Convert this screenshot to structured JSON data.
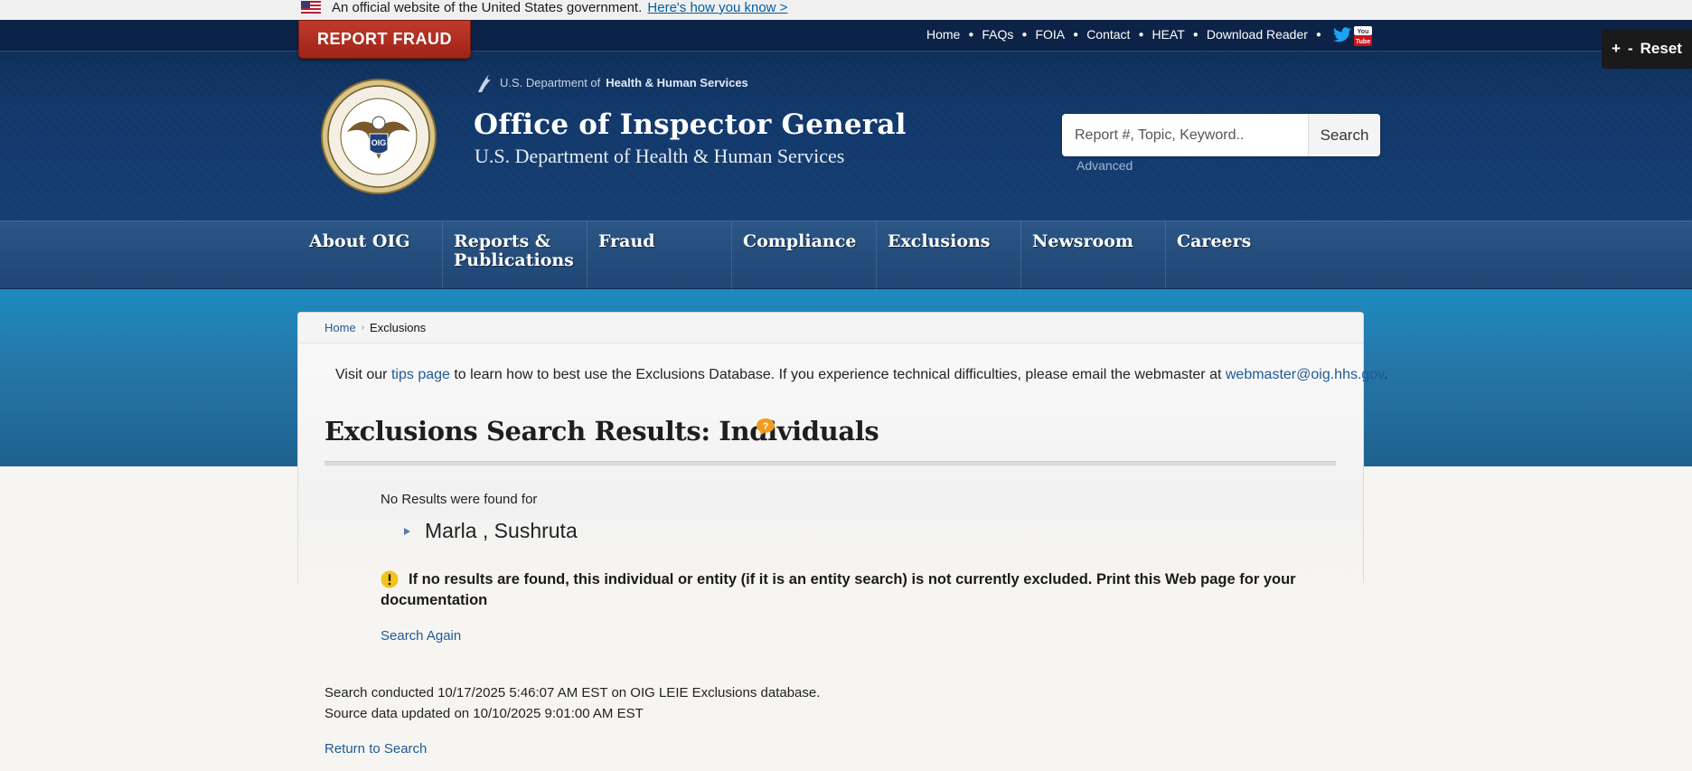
{
  "gov_banner": {
    "text": "An official website of the United States government.",
    "link": "Here's how you know >"
  },
  "header": {
    "report_fraud": "REPORT FRAUD",
    "util_nav": [
      "Home",
      "FAQs",
      "FOIA",
      "Contact",
      "HEAT",
      "Download Reader"
    ],
    "social": [
      "twitter-icon",
      "youtube-icon"
    ],
    "reset": "Reset",
    "zoom_plus": "+",
    "zoom_minus": "-",
    "hhs_prefix": "U.S. Department of",
    "hhs_bold": "Health & Human Services",
    "title": "Office of Inspector General",
    "subtitle": "U.S. Department of Health & Human Services",
    "search_placeholder": "Report #, Topic, Keyword..",
    "search_button": "Search",
    "advanced": "Advanced",
    "seal_text": "OIG"
  },
  "main_nav": [
    "About OIG",
    "Reports & Publications",
    "Fraud",
    "Compliance",
    "Exclusions",
    "Newsroom",
    "Careers"
  ],
  "breadcrumb": {
    "home": "Home",
    "current": "Exclusions"
  },
  "visit": {
    "pre": "Visit our",
    "tips_link": "tips page",
    "mid": "to learn how to best use the Exclusions Database. If you experience technical difficulties, please email the webmaster at",
    "email": "webmaster@oig.hhs.gov",
    "post": "."
  },
  "results": {
    "title": "Exclusions Search Results: Individuals",
    "no_results": "No Results were found for",
    "name": "Marla , Sushruta",
    "warning": "If no results are found, this individual or entity (if it is an entity search) is not currently excluded. Print this Web page for your documentation",
    "search_again": "Search Again",
    "conducted": "Search conducted 10/17/2025 5:46:07 AM EST on OIG LEIE Exclusions database.",
    "updated": "Source data updated on 10/10/2025 9:01:00 AM EST",
    "return": "Return to Search"
  },
  "colors": {
    "header_dark": "#0e2a52",
    "nav": "#2b5685",
    "band": "#1d8bbf",
    "report_red": "#c0392b",
    "link": "#1f5a96",
    "warn_yellow": "#f0c419"
  }
}
